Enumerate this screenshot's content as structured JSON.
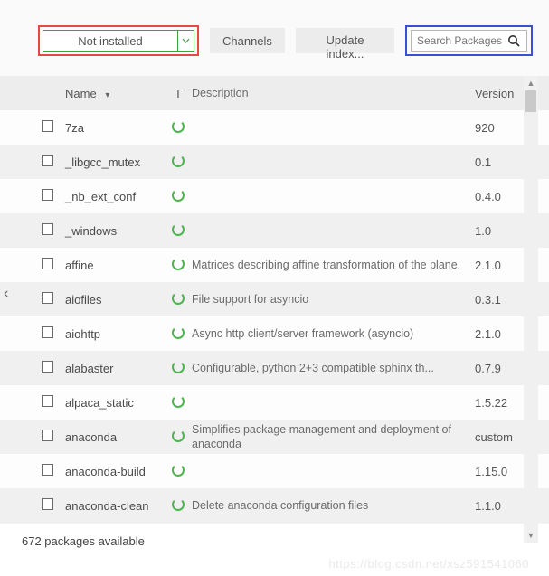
{
  "toolbar": {
    "filter_label": "Not installed",
    "channels_label": "Channels",
    "update_label": "Update index...",
    "search_placeholder": "Search Packages"
  },
  "columns": {
    "name": "Name",
    "type": "T",
    "desc": "Description",
    "version": "Version"
  },
  "packages": [
    {
      "name": "7za",
      "desc": "",
      "version": "920"
    },
    {
      "name": "_libgcc_mutex",
      "desc": "",
      "version": "0.1"
    },
    {
      "name": "_nb_ext_conf",
      "desc": "",
      "version": "0.4.0"
    },
    {
      "name": "_windows",
      "desc": "",
      "version": "1.0"
    },
    {
      "name": "affine",
      "desc": "Matrices describing affine transformation of the plane.",
      "version": "2.1.0"
    },
    {
      "name": "aiofiles",
      "desc": "File support for asyncio",
      "version": "0.3.1"
    },
    {
      "name": "aiohttp",
      "desc": "Async http client/server framework (asyncio)",
      "version": "2.1.0"
    },
    {
      "name": "alabaster",
      "desc": "Configurable, python 2+3 compatible sphinx th...",
      "version": "0.7.9"
    },
    {
      "name": "alpaca_static",
      "desc": "",
      "version": "1.5.22"
    },
    {
      "name": "anaconda",
      "desc": "Simplifies package management and deployment of anaconda",
      "version": "custom"
    },
    {
      "name": "anaconda-build",
      "desc": "",
      "version": "1.15.0"
    },
    {
      "name": "anaconda-clean",
      "desc": "Delete anaconda configuration files",
      "version": "1.1.0"
    }
  ],
  "footer": {
    "status": "672 packages available"
  },
  "watermark": "https://blog.csdn.net/xsz591541060"
}
